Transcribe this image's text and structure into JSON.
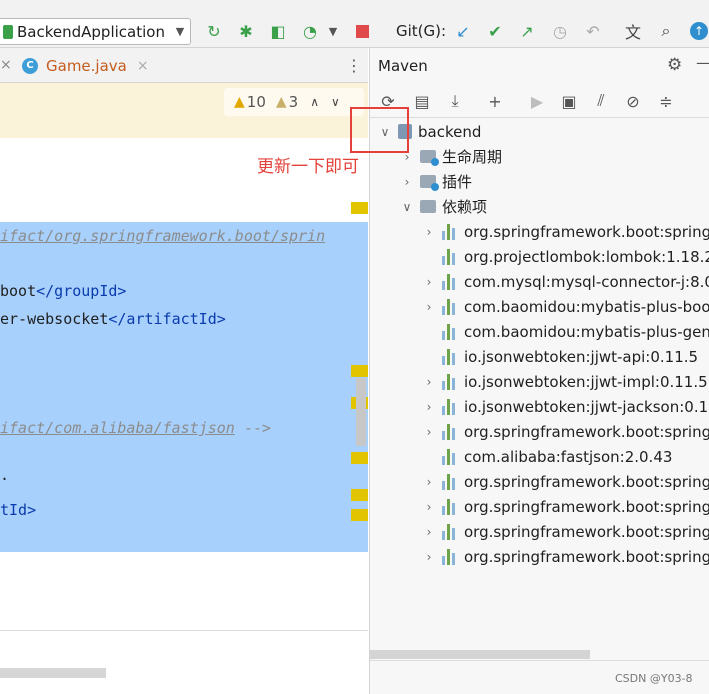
{
  "toolbar": {
    "run_config": "BackendApplication",
    "git_label": "Git(G):",
    "icons": [
      "rerun-icon",
      "debug-icon",
      "coverage-icon",
      "profile-icon",
      "stop-icon",
      "git-update-icon",
      "git-commit-icon",
      "git-push-icon",
      "history-icon",
      "rollback-icon",
      "translate-icon",
      "search-icon",
      "update-ide-icon"
    ]
  },
  "editor": {
    "tab_label": "Game.java",
    "tab_badge": "C",
    "warnings_count": "10",
    "weak_warnings_count": "3",
    "annotation": "更新一下即可",
    "lines": {
      "l1_comment": "ifact/org.springframework.boot/sprin",
      "l2_text": "boot",
      "l2_tag": "</groupId>",
      "l3_text": "er-websocket",
      "l3_tag": "</artifactId>",
      "l4_comment": "ifact/com.alibaba/fastjson",
      "l4_tail": " -->",
      "l5_text": ".",
      "l6_tag": "tId>"
    }
  },
  "maven": {
    "title": "Maven",
    "root": "backend",
    "lifecycle": "生命周期",
    "plugins": "插件",
    "dependencies_label": "依赖项",
    "dependencies": [
      "org.springframework.boot:spring",
      "org.projectlombok:lombok:1.18.2",
      "com.mysql:mysql-connector-j:8.0",
      "com.baomidou:mybatis-plus-boo",
      "com.baomidou:mybatis-plus-gen",
      "io.jsonwebtoken:jjwt-api:0.11.5",
      "io.jsonwebtoken:jjwt-impl:0.11.5",
      "io.jsonwebtoken:jjwt-jackson:0.11",
      "org.springframework.boot:spring",
      "com.alibaba:fastjson:2.0.43",
      "org.springframework.boot:spring",
      "org.springframework.boot:spring",
      "org.springframework.boot:spring",
      "org.springframework.boot:spring"
    ],
    "watermark": "CSDN @Y03-8"
  }
}
